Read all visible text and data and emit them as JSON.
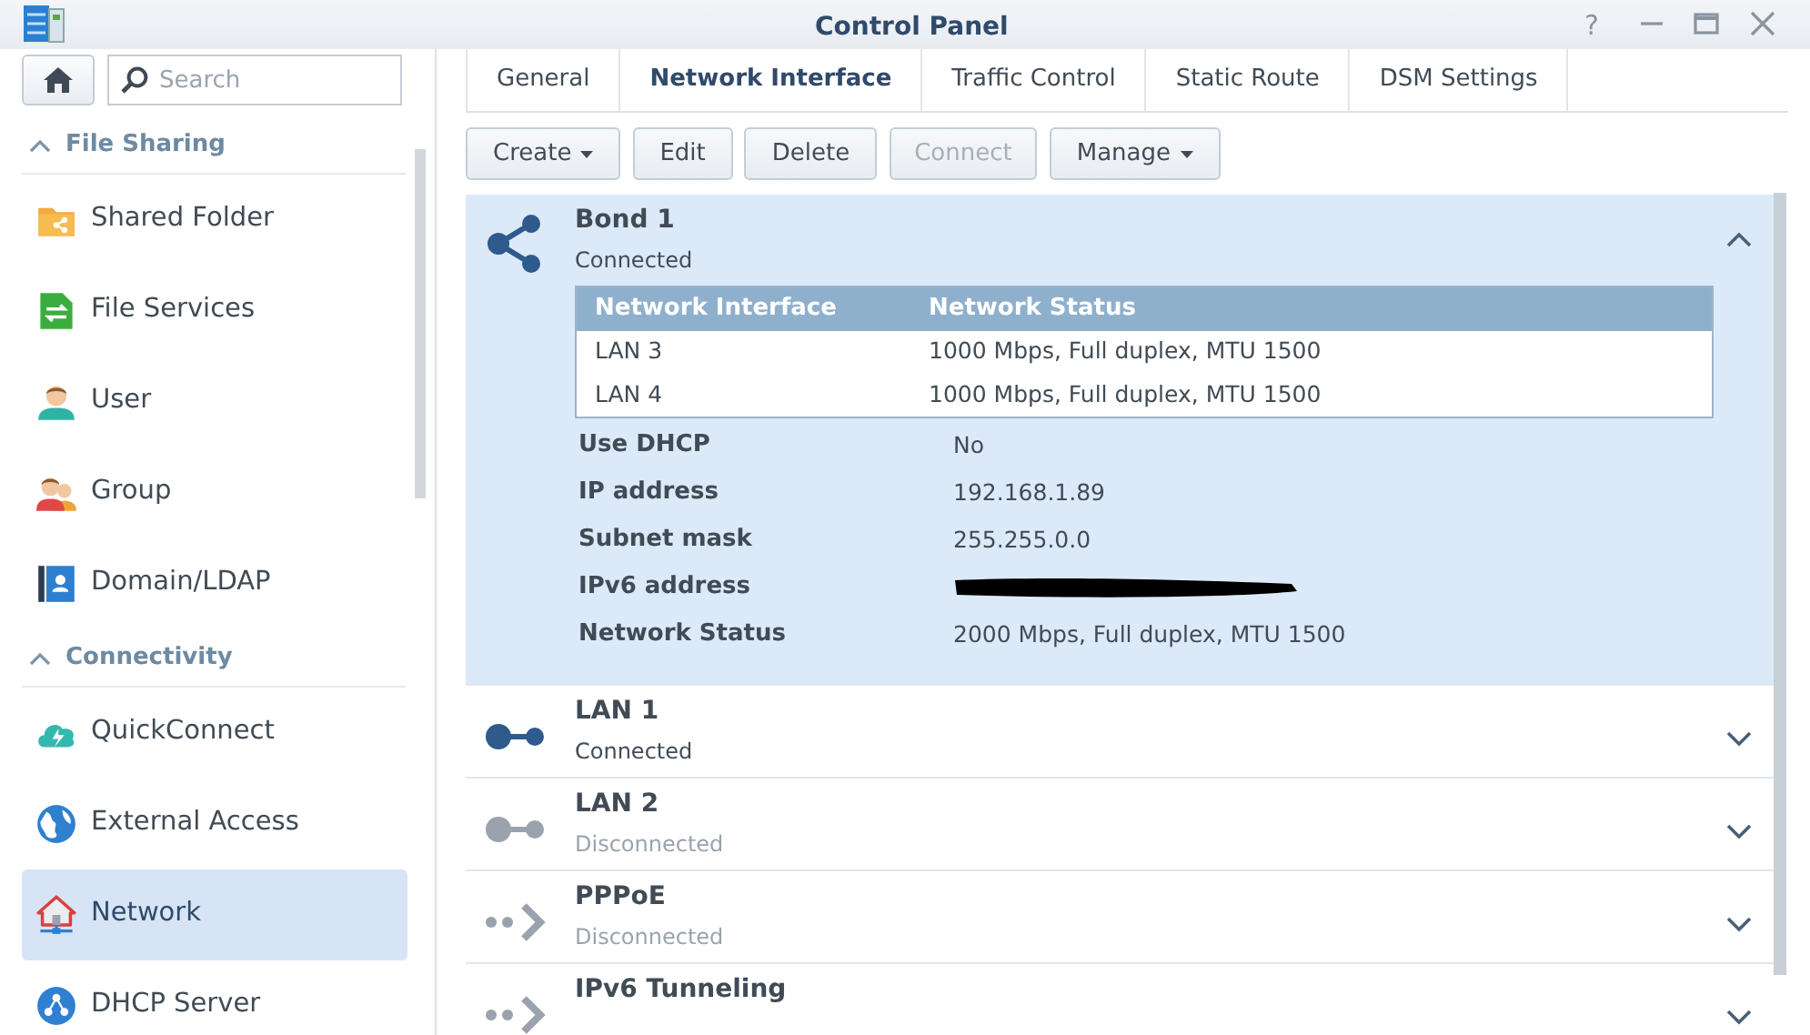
{
  "window": {
    "title": "Control Panel",
    "controls": [
      {
        "kind": "help",
        "label": "?"
      },
      {
        "kind": "minimize"
      },
      {
        "kind": "maximize"
      },
      {
        "kind": "close"
      }
    ]
  },
  "sidebar": {
    "search": {
      "placeholder": "Search"
    },
    "sections": [
      {
        "title": "File Sharing",
        "expanded": true,
        "items": [
          {
            "label": "Shared Folder",
            "kind": "folder",
            "selected": false
          },
          {
            "label": "File Services",
            "kind": "fileservices",
            "selected": false
          },
          {
            "label": "User",
            "kind": "user",
            "selected": false
          },
          {
            "label": "Group",
            "kind": "group",
            "selected": false
          },
          {
            "label": "Domain/LDAP",
            "kind": "domain",
            "selected": false
          }
        ]
      },
      {
        "title": "Connectivity",
        "expanded": true,
        "items": [
          {
            "label": "QuickConnect",
            "kind": "cloud",
            "selected": false
          },
          {
            "label": "External Access",
            "kind": "globe",
            "selected": false
          },
          {
            "label": "Network",
            "kind": "network",
            "selected": true
          },
          {
            "label": "DHCP Server",
            "kind": "dhcp",
            "selected": false
          }
        ]
      }
    ]
  },
  "tabs": [
    {
      "label": "General",
      "selected": false
    },
    {
      "label": "Network Interface",
      "selected": true
    },
    {
      "label": "Traffic Control",
      "selected": false
    },
    {
      "label": "Static Route",
      "selected": false
    },
    {
      "label": "DSM Settings",
      "selected": false
    }
  ],
  "toolbar": [
    {
      "label": "Create",
      "dropdown": true,
      "disabled": false
    },
    {
      "label": "Edit",
      "dropdown": false,
      "disabled": false
    },
    {
      "label": "Delete",
      "dropdown": false,
      "disabled": false
    },
    {
      "label": "Connect",
      "dropdown": false,
      "disabled": true
    },
    {
      "label": "Manage",
      "dropdown": true,
      "disabled": false
    }
  ],
  "interfaces": [
    {
      "name": "Bond 1",
      "status": "Connected",
      "kind": "bond",
      "connected": true,
      "expanded": true,
      "selected": true,
      "members": {
        "columns": [
          "Network Interface",
          "Network Status"
        ],
        "rows": [
          [
            "LAN 3",
            "1000 Mbps, Full duplex, MTU 1500"
          ],
          [
            "LAN 4",
            "1000 Mbps, Full duplex, MTU 1500"
          ]
        ]
      },
      "properties": [
        {
          "label": "Use DHCP",
          "value": "No"
        },
        {
          "label": "IP address",
          "value": "192.168.1.89"
        },
        {
          "label": "Subnet mask",
          "value": "255.255.0.0"
        },
        {
          "label": "IPv6 address",
          "redacted": true
        },
        {
          "label": "Network Status",
          "value": "2000 Mbps, Full duplex, MTU 1500"
        }
      ]
    },
    {
      "name": "LAN 1",
      "status": "Connected",
      "kind": "lan",
      "connected": true,
      "expanded": false,
      "selected": false
    },
    {
      "name": "LAN 2",
      "status": "Disconnected",
      "kind": "lan",
      "connected": false,
      "expanded": false,
      "selected": false
    },
    {
      "name": "PPPoE",
      "status": "Disconnected",
      "kind": "pppoe",
      "connected": false,
      "expanded": false,
      "selected": false
    },
    {
      "name": "IPv6 Tunneling",
      "kind": "pppoe",
      "connected": false,
      "expanded": false,
      "selected": false
    }
  ]
}
